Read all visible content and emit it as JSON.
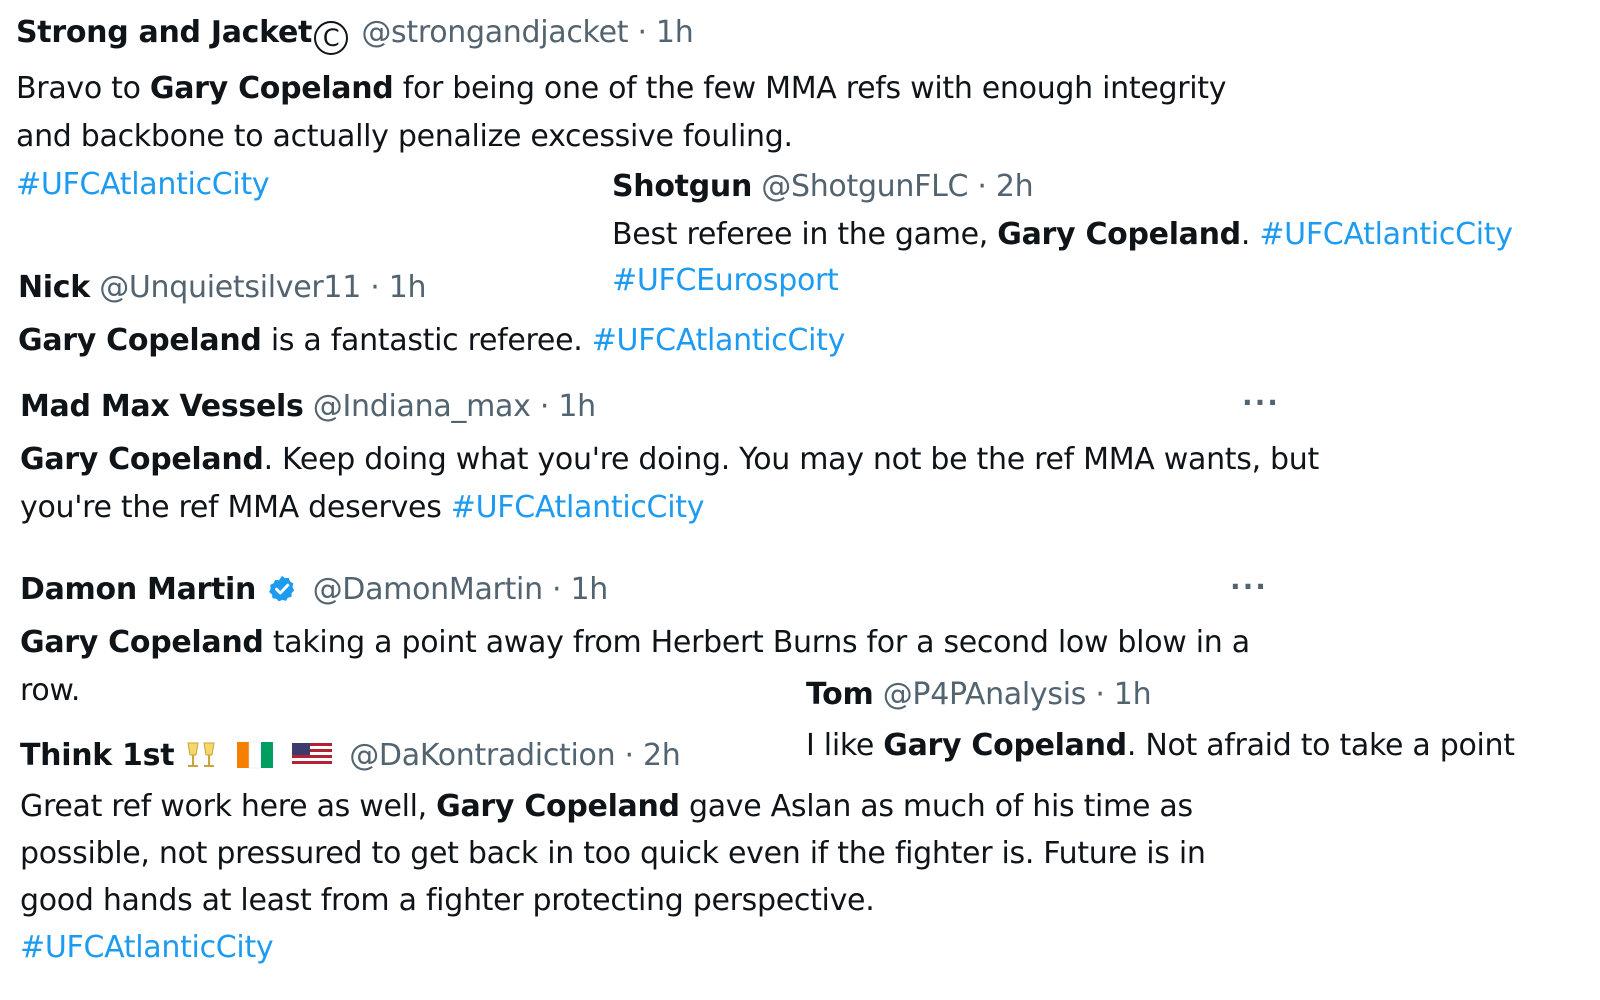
{
  "tweets": [
    {
      "name": "Strong and Jacket",
      "handle": "@strongandjacket",
      "time": "· 1h",
      "text_parts": [
        "Bravo to ",
        "Gary Copeland",
        " for being one of the few MMA refs with enough integrity and backbone to actually penalize excessive fouling."
      ],
      "hashtags": [
        "#UFCAtlanticCity"
      ]
    },
    {
      "name": "Shotgun",
      "handle": "@ShotgunFLC",
      "time": "· 2h",
      "text_parts": [
        "Best referee in the game, ",
        "Gary Copeland",
        ". "
      ],
      "hashtags": [
        "#UFCAtlanticCity",
        "#UFCEurosport"
      ]
    },
    {
      "name": "Nick",
      "handle": "@Unquietsilver11",
      "time": "· 1h",
      "text_parts": [
        "Gary Copeland",
        " is a fantastic referee. "
      ],
      "hashtags": [
        "#UFCAtlanticCity"
      ]
    },
    {
      "name": "Mad Max Vessels",
      "handle": "@Indiana_max",
      "time": "· 1h",
      "text_parts": [
        "Gary Copeland",
        ". Keep doing what you're doing. You may not be the ref MMA wants, but you're the ref MMA deserves "
      ],
      "hashtags": [
        "#UFCAtlanticCity"
      ]
    },
    {
      "name": "Damon Martin",
      "handle": "@DamonMartin",
      "time": "· 1h",
      "text_parts": [
        "Gary Copeland",
        " taking a point away from Herbert Burns for a second low blow in a row."
      ],
      "hashtags": []
    },
    {
      "name": "Tom",
      "handle": "@P4PAnalysis",
      "time": "· 1h",
      "text_parts": [
        "I like ",
        "Gary Copeland",
        ". Not afraid to take a point"
      ],
      "hashtags": []
    },
    {
      "name": "Think 1st",
      "handle": "@DaKontradiction",
      "time": "· 2h",
      "text_parts": [
        "Great ref work here as well, ",
        "Gary Copeland",
        " gave Aslan as much of his time as possible, not pressured to get back in too quick even if the fighter is. Future is in good hands at least from a fighter protecting perspective."
      ],
      "hashtags": [
        "#UFCAtlanticCity"
      ]
    }
  ],
  "more_label": "···",
  "copyright_mark": "C",
  "icons": {
    "verified": "verified-badge-icon",
    "more": "more-options-icon",
    "copyright": "copyright-icon",
    "cheers": "clinking-glasses-emoji",
    "flag_ci": "ivory-coast-flag-emoji",
    "flag_us": "us-flag-emoji"
  },
  "colors": {
    "hashtag": "#1d9bf0",
    "meta": "#536471",
    "text": "#0f1419",
    "verified": "#1d9bf0"
  }
}
